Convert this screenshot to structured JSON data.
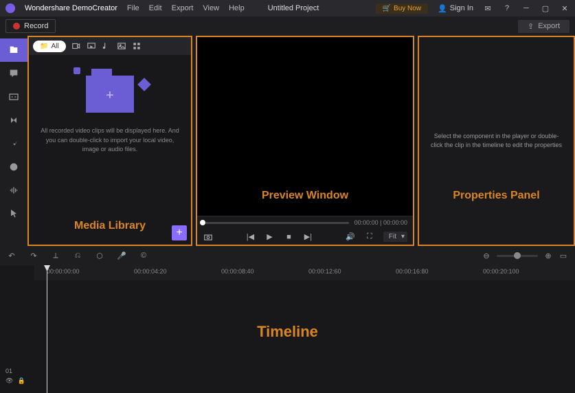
{
  "app": {
    "title": "Wondershare DemoCreator",
    "menus": [
      "File",
      "Edit",
      "Export",
      "View",
      "Help"
    ],
    "project": "Untitled Project",
    "buyNow": "Buy Now",
    "signIn": "Sign In"
  },
  "toolbar": {
    "record": "Record",
    "export": "Export"
  },
  "media": {
    "allTab": "All",
    "emptyText": "All recorded video clips will be displayed here. And you can double-click to import your local video, image or audio files.",
    "label": "Media Library"
  },
  "preview": {
    "label": "Preview Window",
    "time": "00:00:00 | 00:00:00",
    "fit": "Fit"
  },
  "props": {
    "text": "Select the component in the player or double-click the clip in the timeline to edit the properties",
    "label": "Properties Panel"
  },
  "timeline": {
    "label": "Timeline",
    "marks": [
      "00:00:00:00",
      "00:00:04:20",
      "00:00:08:40",
      "00:00:12:60",
      "00:00:16:80",
      "00:00:20:100"
    ],
    "track": "01"
  }
}
